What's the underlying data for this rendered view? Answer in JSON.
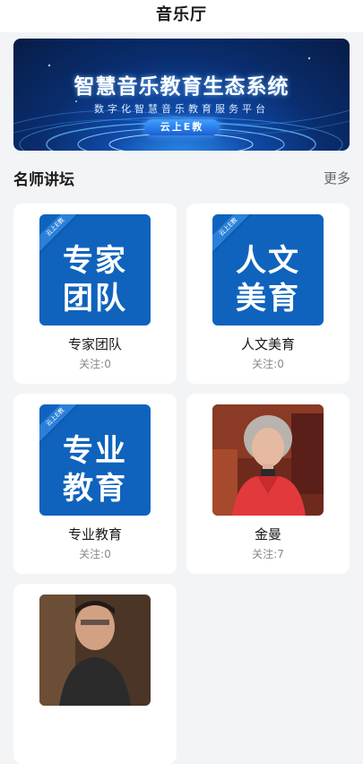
{
  "header": {
    "title": "音乐厅"
  },
  "banner": {
    "title": "智慧音乐教育生态系统",
    "subtitle": "数字化智慧音乐教育服务平台",
    "badge": "云上E教"
  },
  "section": {
    "title": "名师讲坛",
    "more_label": "更多"
  },
  "cards": [
    {
      "name": "专家团队",
      "follow": "关注:0",
      "tile_line1": "专家",
      "tile_line2": "团队",
      "tile_corner": "云上E教"
    },
    {
      "name": "人文美育",
      "follow": "关注:0",
      "tile_line1": "人文",
      "tile_line2": "美育",
      "tile_corner": "云上E教"
    },
    {
      "name": "专业教育",
      "follow": "关注:0",
      "tile_line1": "专业",
      "tile_line2": "教育",
      "tile_corner": "云上E教"
    },
    {
      "name": "金曼",
      "follow": "关注:7"
    }
  ],
  "colors": {
    "tile_blue": "#0f63bd",
    "banner_dark": "#071c46",
    "page_bg": "#f3f4f6"
  }
}
